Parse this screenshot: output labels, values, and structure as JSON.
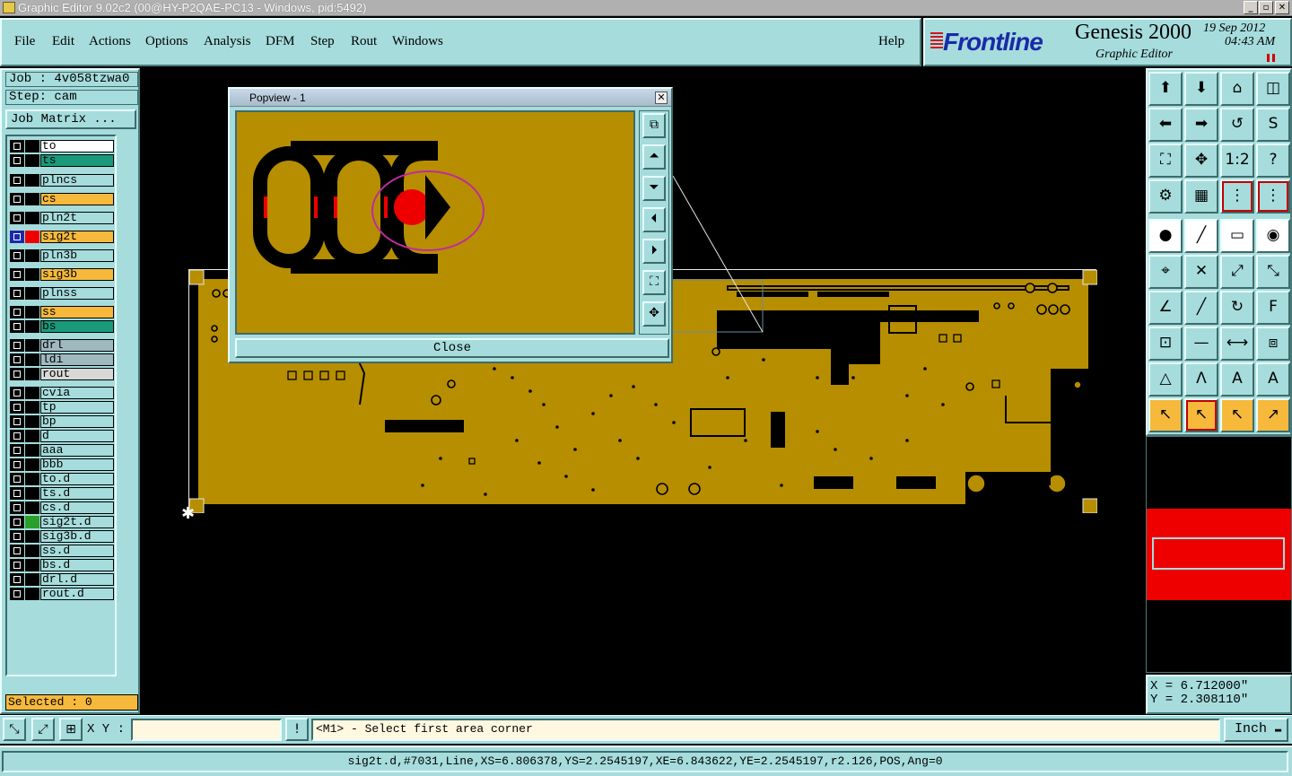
{
  "window": {
    "title": "Graphic Editor 9.02c2 (00@HY-P2QAE-PC13 - Windows, pid:5492)"
  },
  "menu": [
    "File",
    "Edit",
    "Actions",
    "Options",
    "Analysis",
    "DFM",
    "Step",
    "Rout",
    "Windows"
  ],
  "help": "Help",
  "logo": {
    "brand": "Frontline",
    "product": "Genesis 2000",
    "subtitle": "Graphic Editor",
    "date": "19 Sep 2012",
    "time": "04:43 AM"
  },
  "job": "Job : 4v058tzwa0",
  "step": "Step: cam",
  "job_matrix": "Job Matrix ...",
  "layers": [
    {
      "name": "to",
      "color": "#ffffff"
    },
    {
      "name": "ts",
      "color": "#1a9a7a"
    },
    {
      "name": "plncs",
      "color": "#a6dcdc"
    },
    {
      "name": "cs",
      "color": "#f6b93c"
    },
    {
      "name": "pln2t",
      "color": "#a6dcdc"
    },
    {
      "name": "sig2t",
      "color": "#f6b93c"
    },
    {
      "name": "pln3b",
      "color": "#a6dcdc"
    },
    {
      "name": "sig3b",
      "color": "#f6b93c"
    },
    {
      "name": "plnss",
      "color": "#a6dcdc"
    },
    {
      "name": "ss",
      "color": "#f6b93c"
    },
    {
      "name": "bs",
      "color": "#1a9a7a"
    },
    {
      "name": "drl",
      "color": "#a0b8c0"
    },
    {
      "name": "ldi",
      "color": "#a0b8c0"
    },
    {
      "name": "rout",
      "color": "#d8d8d8"
    },
    {
      "name": "cvia",
      "color": "#a6dcdc"
    },
    {
      "name": "tp",
      "color": "#a6dcdc"
    },
    {
      "name": "bp",
      "color": "#a6dcdc"
    },
    {
      "name": "d",
      "color": "#a6dcdc"
    },
    {
      "name": "aaa",
      "color": "#a6dcdc"
    },
    {
      "name": "bbb",
      "color": "#a6dcdc"
    },
    {
      "name": "to.d",
      "color": "#a6dcdc"
    },
    {
      "name": "ts.d",
      "color": "#a6dcdc"
    },
    {
      "name": "cs.d",
      "color": "#a6dcdc"
    },
    {
      "name": "sig2t.d",
      "color": "#a6dcdc"
    },
    {
      "name": "sig3b.d",
      "color": "#a6dcdc"
    },
    {
      "name": "ss.d",
      "color": "#a6dcdc"
    },
    {
      "name": "bs.d",
      "color": "#a6dcdc"
    },
    {
      "name": "drl.d",
      "color": "#a6dcdc"
    },
    {
      "name": "rout.d",
      "color": "#a6dcdc"
    }
  ],
  "selected": "Selected : 0",
  "popview": {
    "title": "Popview - 1",
    "close": "Close"
  },
  "coords": {
    "x": "X = 6.712000\"",
    "y": "Y = 2.308110\""
  },
  "cmd": {
    "xy_label": "X Y :",
    "xy_value": "",
    "prompt": "<M1> - Select first area corner",
    "unit": "Inch"
  },
  "status": "sig2t.d,#7031,Line,XS=6.806378,YS=2.2545197,XE=6.843622,YE=2.2545197,r2.126,POS,Ang=0",
  "colors": {
    "panel": "#a6dcdc",
    "board": "#b78e00",
    "accent_orange": "#f6b93c",
    "highlight_red": "#ee0000"
  }
}
